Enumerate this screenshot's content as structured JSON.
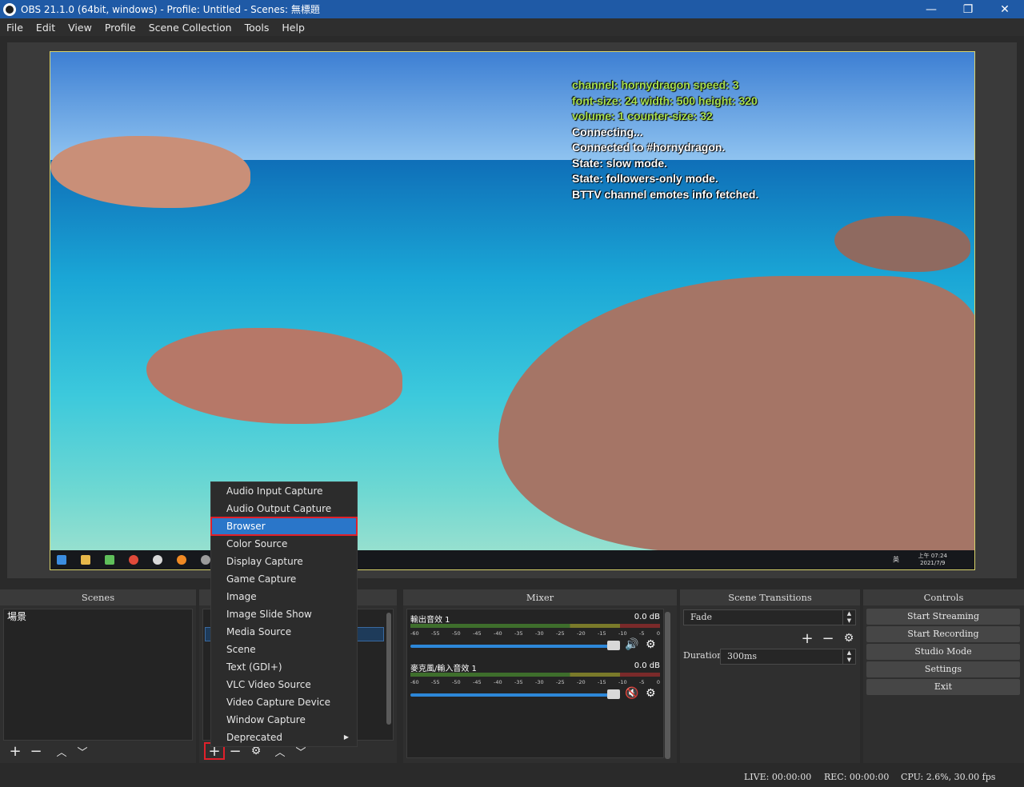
{
  "window": {
    "title": "OBS 21.1.0 (64bit, windows) - Profile: Untitled - Scenes: 無標題",
    "minimize": "—",
    "maximize": "❐",
    "close": "✕"
  },
  "menubar": [
    "File",
    "Edit",
    "View",
    "Profile",
    "Scene Collection",
    "Tools",
    "Help"
  ],
  "preview": {
    "overlay_green": [
      "channel: hornydragon speed: 3",
      "font-size: 24 width: 500 height: 320",
      "volume: 1 counter-size: 32"
    ],
    "overlay_white": [
      "Connecting...",
      "Connected to #hornydragon.",
      "State: slow mode.",
      "State: followers-only mode.",
      "BTTV channel emotes info fetched."
    ],
    "taskbar_clock_time": "上午 07:24",
    "taskbar_clock_date": "2021/7/9",
    "taskbar_lang": "英"
  },
  "docks": {
    "scenes": {
      "title": "Scenes",
      "items": [
        "場景"
      ]
    },
    "mixer": {
      "title": "Mixer",
      "channels": [
        {
          "name": "輸出音效 1",
          "db": "0.0 dB",
          "muted": false
        },
        {
          "name": "麥克風/輸入音效 1",
          "db": "0.0 dB",
          "muted": true
        }
      ],
      "ticks": [
        "-60",
        "-55",
        "-50",
        "-45",
        "-40",
        "-35",
        "-30",
        "-25",
        "-20",
        "-15",
        "-10",
        "-5",
        "0"
      ]
    },
    "transitions": {
      "title": "Scene Transitions",
      "selected": "Fade",
      "duration_label": "Duration",
      "duration_value": "300ms"
    },
    "controls": {
      "title": "Controls",
      "buttons": [
        "Start Streaming",
        "Start Recording",
        "Studio Mode",
        "Settings",
        "Exit"
      ]
    }
  },
  "context_menu": {
    "items": [
      "Audio Input Capture",
      "Audio Output Capture",
      "Browser",
      "Color Source",
      "Display Capture",
      "Game Capture",
      "Image",
      "Image Slide Show",
      "Media Source",
      "Scene",
      "Text (GDI+)",
      "VLC Video Source",
      "Video Capture Device",
      "Window Capture",
      "Deprecated"
    ],
    "highlighted": "Browser"
  },
  "statusbar": {
    "live": "LIVE: 00:00:00",
    "rec": "REC: 00:00:00",
    "cpu": "CPU: 2.6%, 30.00 fps"
  },
  "colors": {
    "titlebar": "#1f5aa6",
    "accent": "#2a76c9",
    "highlight_border": "#e0202a"
  }
}
